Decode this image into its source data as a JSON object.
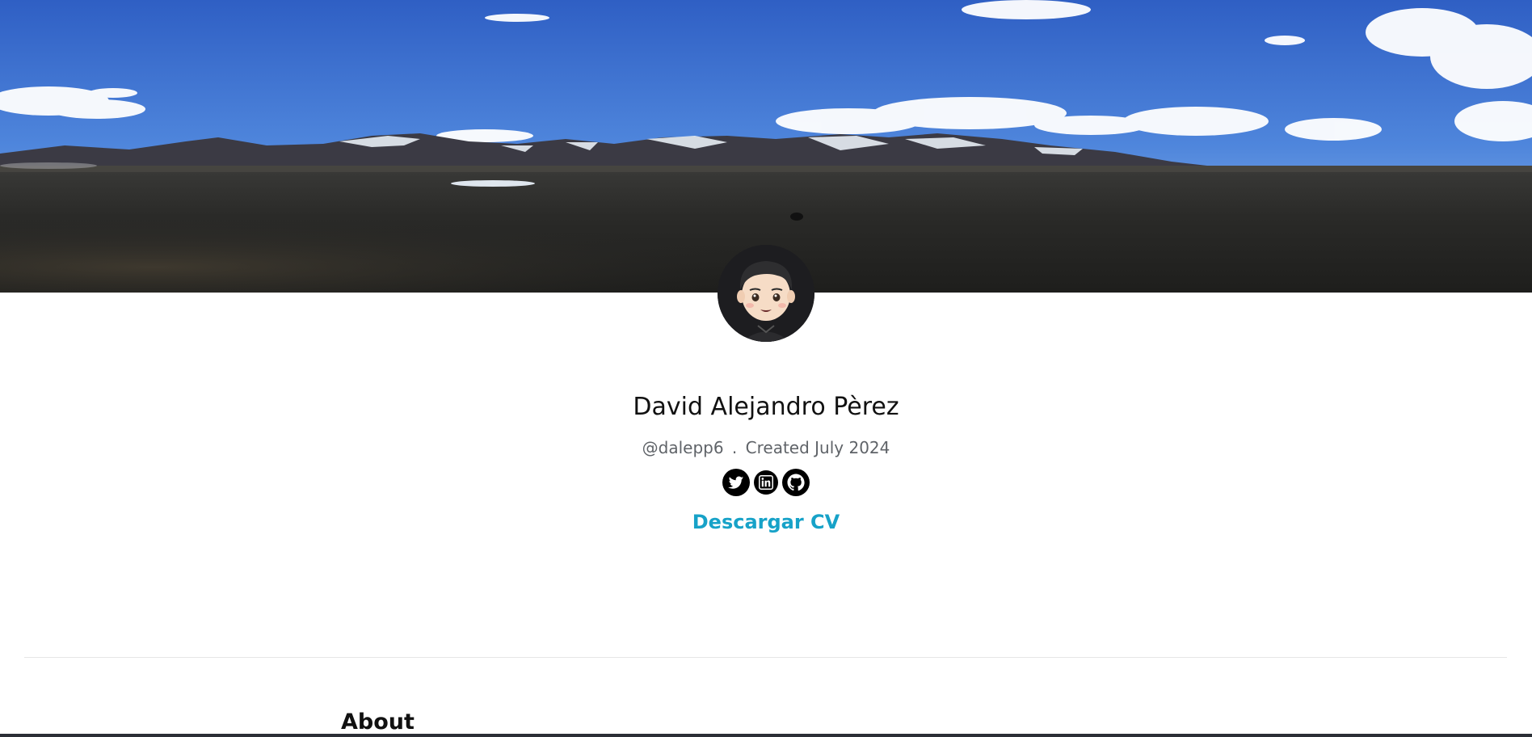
{
  "profile": {
    "name": "David Alejandro Pèrez",
    "handle": "@dalepp6",
    "separator": ".",
    "created": "Created July 2024"
  },
  "socials": [
    {
      "icon": "twitter-icon"
    },
    {
      "icon": "linkedin-icon"
    },
    {
      "icon": "github-icon"
    }
  ],
  "cv_link": {
    "label": "Descargar CV"
  },
  "sections": {
    "about_title": "About"
  },
  "colors": {
    "accent": "#17a2c8",
    "name_text": "#111111",
    "meta_text": "#5f6368"
  }
}
